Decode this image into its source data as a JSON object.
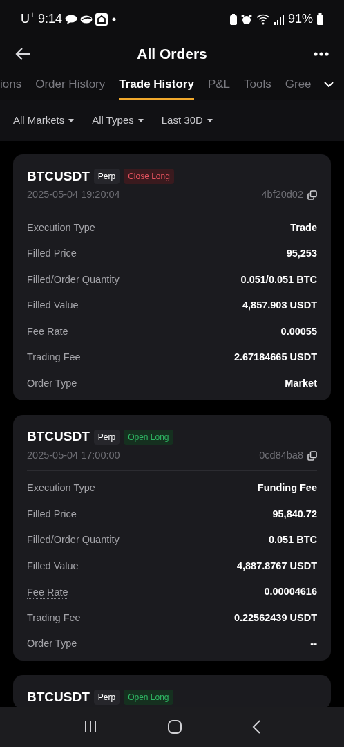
{
  "status_bar": {
    "carrier": "U$^{+}$",
    "time": "9:14",
    "battery": "91%"
  },
  "header": {
    "title": "All Orders"
  },
  "tabs": [
    {
      "label": "ions",
      "selected": false
    },
    {
      "label": "Order History",
      "selected": false
    },
    {
      "label": "Trade History",
      "selected": true
    },
    {
      "label": "P&L",
      "selected": false
    },
    {
      "label": "Tools",
      "selected": false
    },
    {
      "label": "Gree",
      "selected": false
    }
  ],
  "filters": [
    "All Markets",
    "All Types",
    "Last 30D"
  ],
  "orders": [
    {
      "symbol": "BTCUSDT",
      "type": "Perp",
      "side": {
        "label": "Close Long",
        "kind": "close"
      },
      "time": "2025-05-04 19:20:04",
      "id": "4bf20d02",
      "fields": [
        {
          "label": "Execution Type",
          "value": "Trade",
          "hint": false
        },
        {
          "label": "Filled Price",
          "value": "95,253",
          "hint": false
        },
        {
          "label": "Filled/Order Quantity",
          "value": "0.051/0.051 BTC",
          "hint": false
        },
        {
          "label": "Filled Value",
          "value": "4,857.903 USDT",
          "hint": false
        },
        {
          "label": "Fee Rate",
          "value": "0.00055",
          "hint": true
        },
        {
          "label": "Trading Fee",
          "value": "2.67184665 USDT",
          "hint": false
        },
        {
          "label": "Order Type",
          "value": "Market",
          "hint": false
        }
      ]
    },
    {
      "symbol": "BTCUSDT",
      "type": "Perp",
      "side": {
        "label": "Open Long",
        "kind": "open"
      },
      "time": "2025-05-04 17:00:00",
      "id": "0cd84ba8",
      "fields": [
        {
          "label": "Execution Type",
          "value": "Funding Fee",
          "hint": false
        },
        {
          "label": "Filled Price",
          "value": "95,840.72",
          "hint": false
        },
        {
          "label": "Filled/Order Quantity",
          "value": "0.051 BTC",
          "hint": false
        },
        {
          "label": "Filled Value",
          "value": "4,887.8767 USDT",
          "hint": false
        },
        {
          "label": "Fee Rate",
          "value": "0.00004616",
          "hint": true
        },
        {
          "label": "Trading Fee",
          "value": "0.22562439 USDT",
          "hint": false
        },
        {
          "label": "Order Type",
          "value": "--",
          "hint": false
        }
      ]
    },
    {
      "symbol": "BTCUSDT",
      "type": "Perp",
      "side": {
        "label": "Open Long",
        "kind": "open"
      }
    }
  ]
}
